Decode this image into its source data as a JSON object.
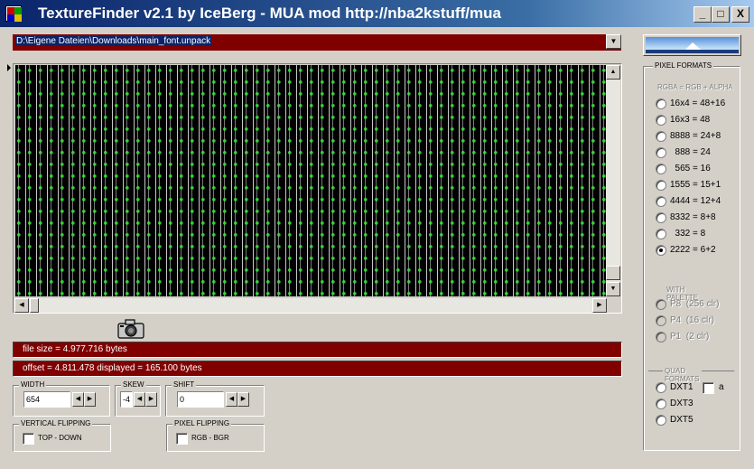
{
  "window": {
    "title": "TextureFinder v2.1 by IceBerg - MUA mod http://nba2kstuff/mua",
    "minimize_label": "_",
    "maximize_label": "□",
    "close_label": "X"
  },
  "path": {
    "value": "D:\\Eigene Dateien\\Downloads\\main_font.unpack",
    "dropdown_icon": "▼"
  },
  "logo": {
    "icon": "iceberg-logo"
  },
  "info": {
    "file_size": "file size = 4.977.716 bytes",
    "offset": "offset = 4.811.478   displayed = 165.100 bytes"
  },
  "width": {
    "label": "WIDTH",
    "value": "654"
  },
  "skew": {
    "label": "SKEW",
    "value": "-4"
  },
  "shift": {
    "label": "SHIFT",
    "value": "0"
  },
  "vertical_flipping": {
    "label": "VERTICAL FLIPPING",
    "option": "TOP - DOWN"
  },
  "pixel_flipping": {
    "label": "PIXEL FLIPPING",
    "option": "RGB  -  BGR"
  },
  "pixel_formats": {
    "label": "PIXEL FORMATS",
    "rgba_label": "RGBA = RGB + ALPHA",
    "options": [
      "16x4 = 48+16",
      "16x3 = 48",
      "8888 = 24+8",
      "  888 = 24",
      "  565 = 16",
      "1555 = 15+1",
      "4444 = 12+4",
      "8332 = 8+8",
      "  332 = 8",
      "2222 = 6+2"
    ],
    "selected": "2222 = 6+2",
    "palette_label": "WITH PALETTE",
    "palette_options": [
      "P8  (256 clr)",
      "P4  (16 clr)",
      "P1  (2 clr)"
    ],
    "quad_label": "QUAD FORMATS",
    "quad_options": [
      "DXT1",
      "DXT3",
      "DXT5"
    ],
    "alpha_label": "a"
  },
  "colors": {
    "title_start": "#0a246a",
    "title_end": "#a6caf0",
    "info_bg": "#800000",
    "face": "#d4d0c8"
  }
}
